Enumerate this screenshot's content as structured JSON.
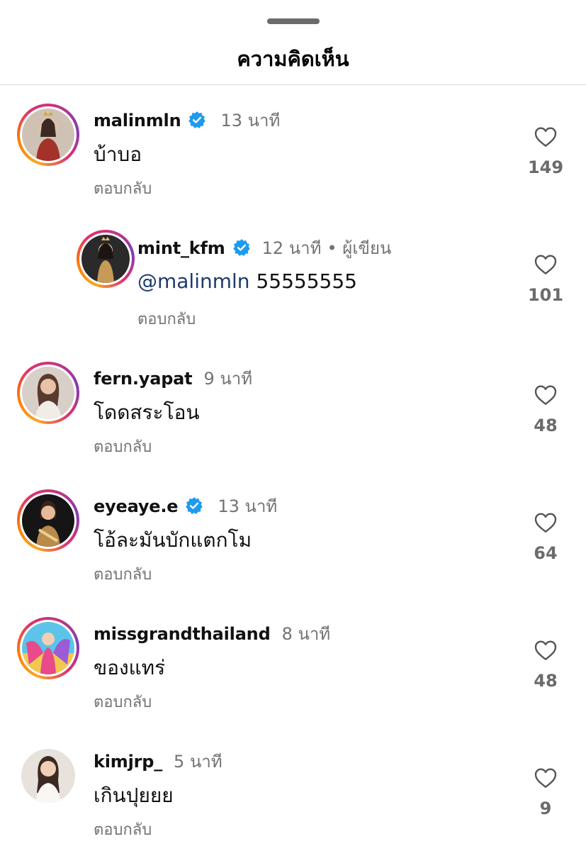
{
  "header": {
    "title": "ความคิดเห็น"
  },
  "comments": [
    {
      "username": "malinmln",
      "verified": true,
      "time": "13 นาที",
      "text": "บ้าบอ",
      "reply": "ตอบกลับ",
      "likes": "149",
      "avatar_colors": [
        "#d98d7a",
        "#a4322a",
        "#f2d6c8"
      ]
    },
    {
      "username": "mint_kfm",
      "verified": true,
      "time": "12 นาที",
      "author_badge": "• ผู้เขียน",
      "mention": "@malinmln",
      "text": "55555555",
      "reply": "ตอบกลับ",
      "likes": "101",
      "avatar_colors": [
        "#2a2a2a",
        "#c79a57",
        "#e9c9a8"
      ]
    },
    {
      "username": "fern.yapat",
      "verified": false,
      "time": "9 นาที",
      "text": "โดดสระโอน",
      "reply": "ตอบกลับ",
      "likes": "48",
      "avatar_colors": [
        "#d9cfc9",
        "#5a3a2e",
        "#e8c3a8"
      ]
    },
    {
      "username": "eyeaye.e",
      "verified": true,
      "time": "13 นาที",
      "text": "โอ้ละมันบักแตกโม",
      "reply": "ตอบกลับ",
      "likes": "64",
      "avatar_colors": [
        "#111111",
        "#b88a4b",
        "#e6b999"
      ]
    },
    {
      "username": "missgrandthailand",
      "verified": false,
      "time": "8 นาที",
      "text": "ของแทร่",
      "reply": "ตอบกลับ",
      "likes": "48",
      "avatar_colors": [
        "#5cc4e8",
        "#e84a8a",
        "#f3c84f"
      ]
    },
    {
      "username": "kimjrp_",
      "verified": false,
      "time": "5 นาที",
      "text": "เกินปุยยย",
      "reply": "ตอบกลับ",
      "likes": "9",
      "avatar_colors": [
        "#e8e2dc",
        "#3a2a22",
        "#f1cfb6"
      ]
    }
  ],
  "icons": {
    "verified": "verified-badge-icon",
    "like": "heart-outline-icon"
  },
  "colors": {
    "verified_blue": "#1d9bf0",
    "secondary_text": "#737373",
    "mention": "#1e3a6e"
  }
}
